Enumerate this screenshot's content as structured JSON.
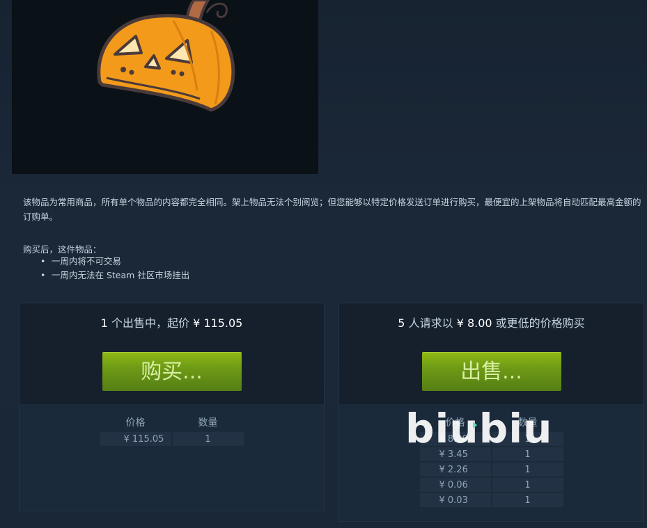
{
  "description": "该物品为常用商品，所有单个物品的内容都完全相同。架上物品无法个别阅览；但您能够以特定价格发送订单进行购买，最便宜的上架物品将自动匹配最高金额的订购单。",
  "after_purchase": {
    "title": "购买后，这件物品：",
    "items": [
      "一周内将不可交易",
      "一周内无法在 Steam 社区市场挂出"
    ]
  },
  "sell_listings": {
    "count": "1",
    "header_middle": "个出售中，起价",
    "price": "¥ 115.05",
    "button_label": "购买...",
    "columns": [
      "价格",
      "数量"
    ],
    "rows": [
      {
        "price": "¥ 115.05",
        "qty": "1"
      }
    ]
  },
  "buy_orders": {
    "count": "5",
    "header_middle": "人请求以",
    "price": "¥ 8.00",
    "header_tail": "或更低的价格购买",
    "button_label": "出售...",
    "columns": [
      "价格",
      "数量"
    ],
    "rows": [
      {
        "price": "¥ 8.00",
        "qty": "1"
      },
      {
        "price": "¥ 3.45",
        "qty": "1"
      },
      {
        "price": "¥ 2.26",
        "qty": "1"
      },
      {
        "price": "¥ 0.06",
        "qty": "1"
      },
      {
        "price": "¥ 0.03",
        "qty": "1"
      }
    ]
  },
  "watermark": "biubiu",
  "colors": {
    "background": "#1b2838",
    "button_green": "#6e9a16",
    "pumpkin_orange": "#f39a1b",
    "outline": "#4a3a3a"
  }
}
